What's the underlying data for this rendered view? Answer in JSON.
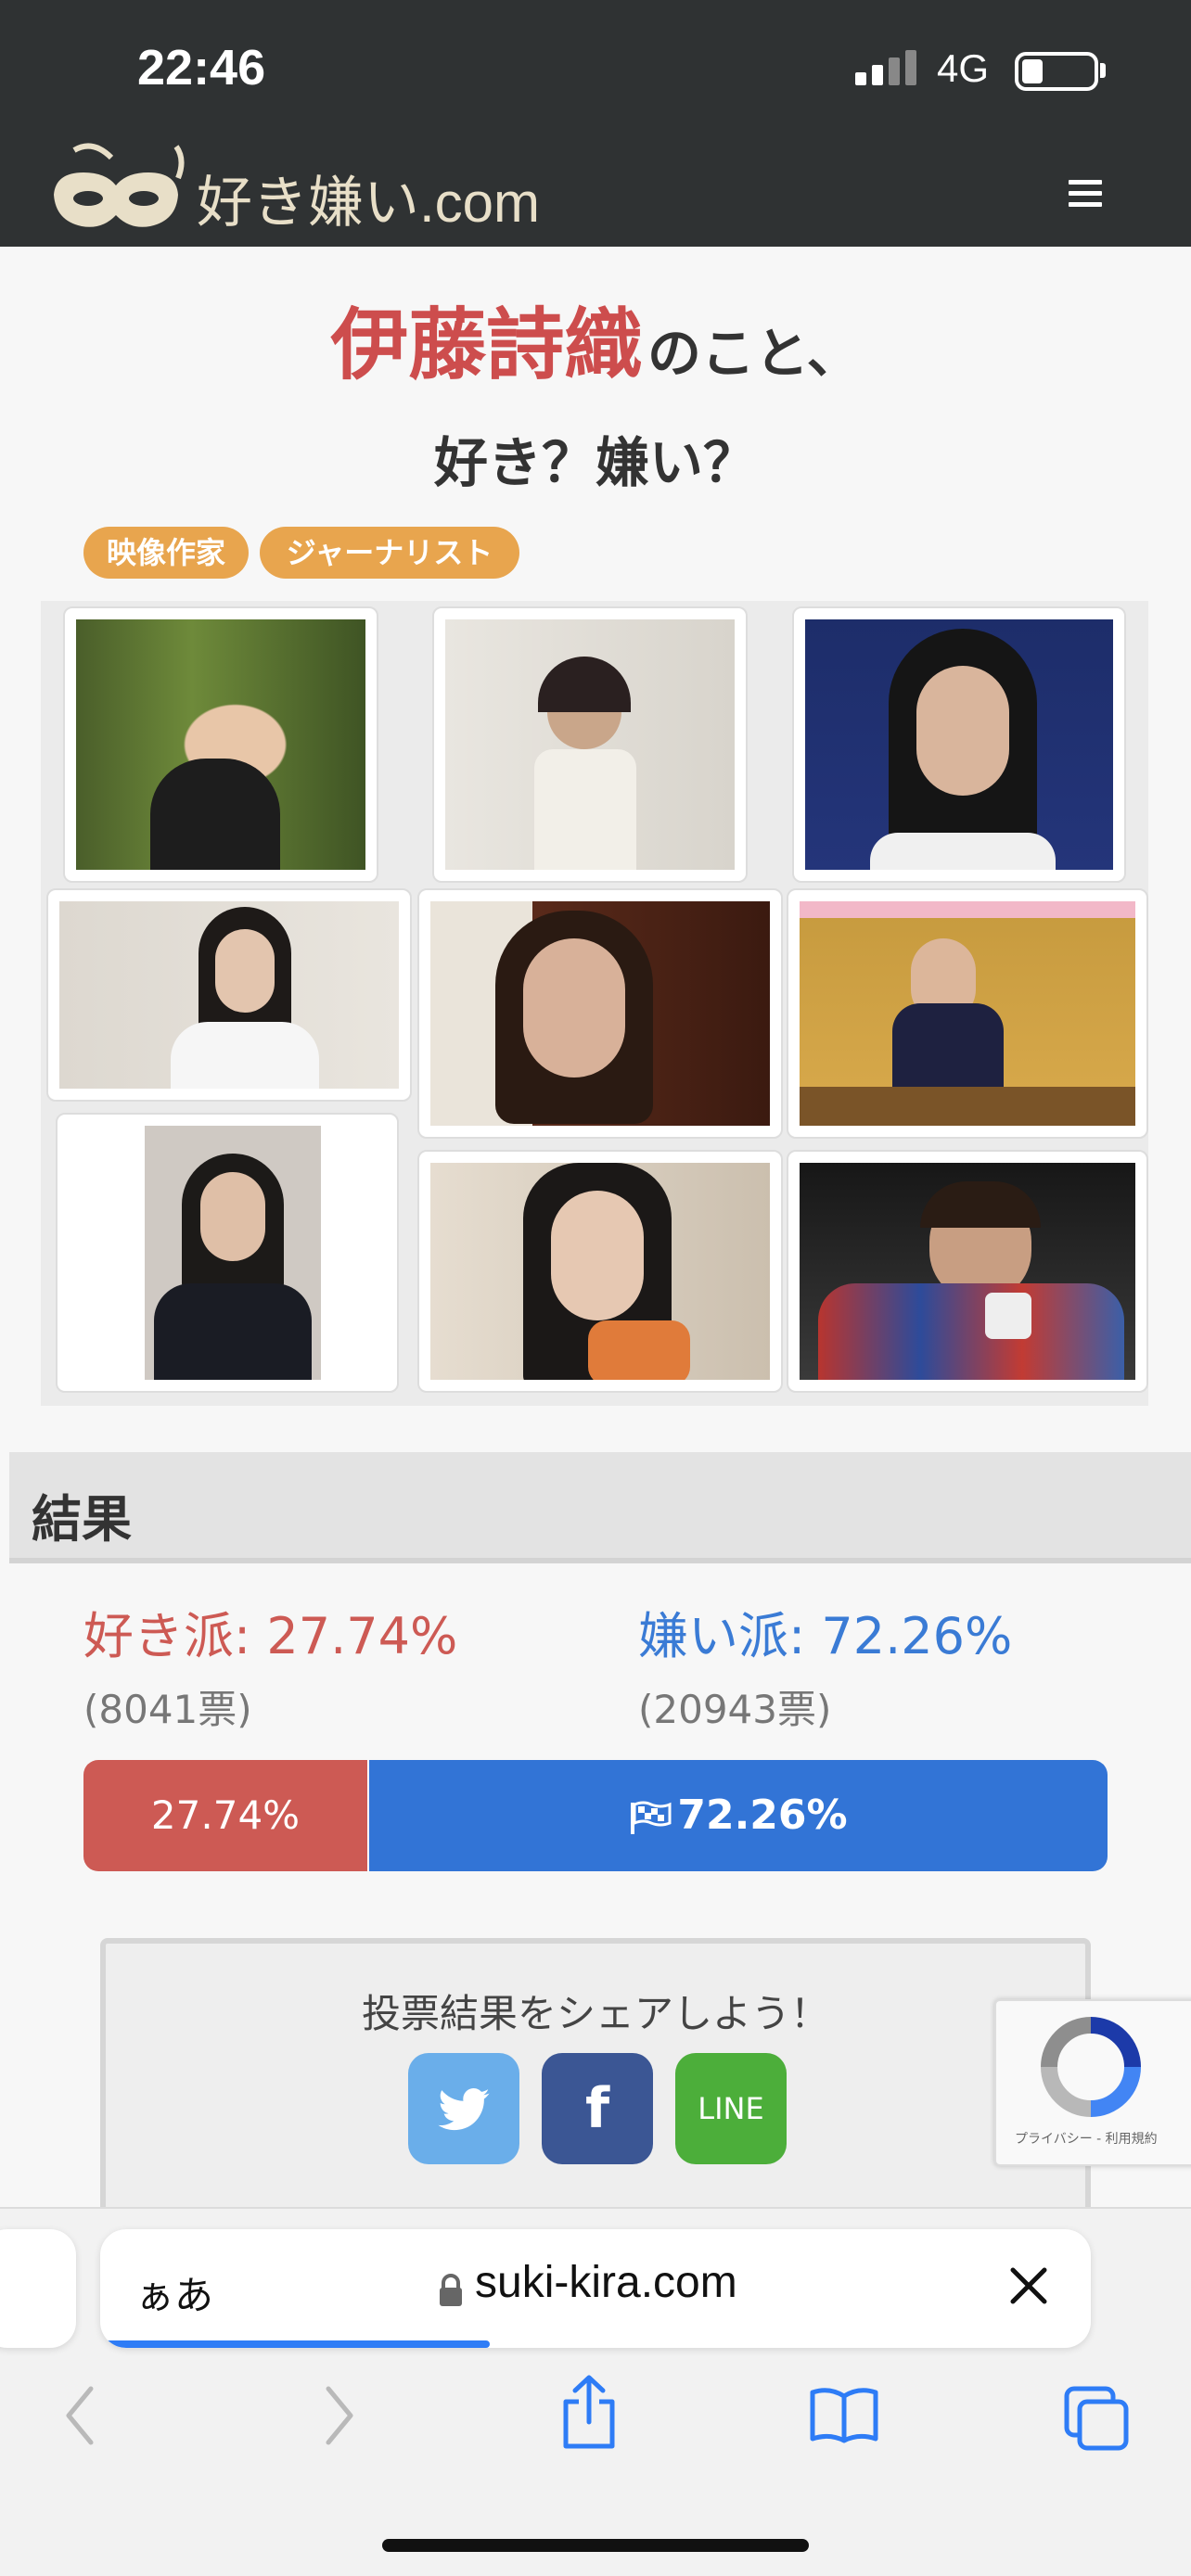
{
  "status_bar": {
    "time": "22:46",
    "network": "4G"
  },
  "header": {
    "logo_text": "好き嫌い.com",
    "icon": "hamburger-menu-icon"
  },
  "title": {
    "name": "伊藤詩織",
    "suffix": "のこと、",
    "question": "好き？嫌い？"
  },
  "tags": [
    "映像作家",
    "ジャーナリスト"
  ],
  "results": {
    "section_title": "結果",
    "like_label": "好き派: 27.74%",
    "like_votes": "(8041票)",
    "dislike_label": "嫌い派: 72.26%",
    "dislike_votes": "(20943票)",
    "like_bar_text": "27.74%",
    "dislike_bar_text": "72.26%",
    "like_fraction": 0.2774,
    "colors": {
      "like": "#cd5a54",
      "dislike": "#3274d6"
    }
  },
  "share": {
    "text": "投票結果をシェアしよう！",
    "line_label": "LINE"
  },
  "recaptcha": {
    "text": "プライバシー - 利用規約"
  },
  "browser": {
    "aa_label": "ぁあ",
    "url": "suki-kira.com"
  }
}
